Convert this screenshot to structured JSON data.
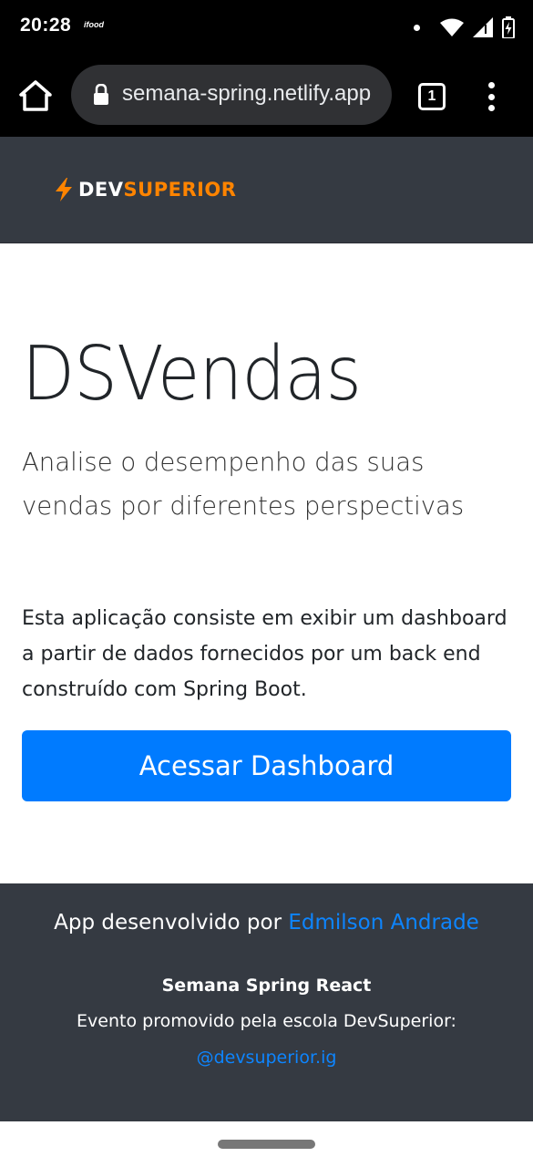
{
  "status_bar": {
    "time": "20:28",
    "notification_app": "ifood",
    "icons": [
      "dot-icon",
      "wifi-icon",
      "signal-icon",
      "battery-charging-icon"
    ]
  },
  "browser": {
    "url": "semana-spring.netlify.app",
    "tab_count": "1",
    "icons": [
      "home-icon",
      "lock-icon",
      "tabs-icon",
      "more-vert-icon"
    ]
  },
  "header": {
    "logo_dev": "DEV",
    "logo_superior": "SUPERIOR",
    "logo_icon": "lightning-bolt-icon",
    "brand_color": "#ff8400",
    "background": "#353a42"
  },
  "hero": {
    "title": "DSVendas",
    "lead": "Analise o desempenho das suas vendas por diferentes perspectivas",
    "description": "Esta aplicação consiste em exibir um dashboard a partir de dados fornecidos por um back end construído com Spring Boot.",
    "button_label": "Acessar Dashboard",
    "button_color": "#007bff"
  },
  "footer": {
    "developed_by": "App desenvolvido por",
    "developer_name": "Edmilson Andrade",
    "event_title": "Semana Spring React",
    "event_text": "Evento promovido pela escola DevSuperior:",
    "instagram_handle": "@devsuperior.ig",
    "link_color": "#0d85ff"
  }
}
